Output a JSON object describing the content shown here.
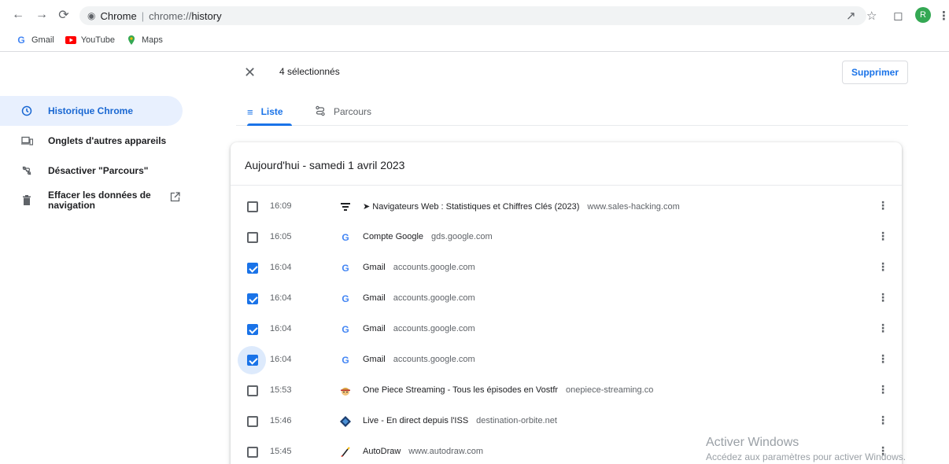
{
  "browser": {
    "origin": "Chrome",
    "url_scheme": "chrome://",
    "url_path": "history",
    "avatar_letter": "R"
  },
  "bookmarks": [
    {
      "label": "Gmail",
      "icon": "gmail-g-icon"
    },
    {
      "label": "YouTube",
      "icon": "youtube-icon"
    },
    {
      "label": "Maps",
      "icon": "maps-icon"
    }
  ],
  "selection": {
    "count_label": "4 sélectionnés",
    "delete_label": "Supprimer"
  },
  "sidebar": {
    "items": [
      {
        "label": "Historique Chrome",
        "icon": "clock-icon",
        "active": true
      },
      {
        "label": "Onglets d'autres appareils",
        "icon": "devices-icon"
      },
      {
        "label": "Désactiver \"Parcours\"",
        "icon": "journeys-off-icon"
      },
      {
        "label": "Effacer les données de navigation",
        "icon": "trash-icon"
      }
    ]
  },
  "tabs": {
    "list_label": "Liste",
    "journeys_label": "Parcours"
  },
  "history": {
    "date_header": "Aujourd'hui - samedi 1 avril 2023",
    "rows": [
      {
        "time": "16:09",
        "title": "➤ Navigateurs Web : Statistiques et Chiffres Clés (2023)",
        "domain": "www.sales-hacking.com",
        "checked": false
      },
      {
        "time": "16:05",
        "title": "Compte Google",
        "domain": "gds.google.com",
        "checked": false
      },
      {
        "time": "16:04",
        "title": "Gmail",
        "domain": "accounts.google.com",
        "checked": true
      },
      {
        "time": "16:04",
        "title": "Gmail",
        "domain": "accounts.google.com",
        "checked": true
      },
      {
        "time": "16:04",
        "title": "Gmail",
        "domain": "accounts.google.com",
        "checked": true
      },
      {
        "time": "16:04",
        "title": "Gmail",
        "domain": "accounts.google.com",
        "checked": true
      },
      {
        "time": "15:53",
        "title": "One Piece Streaming - Tous les épisodes en Vostfr",
        "domain": "onepiece-streaming.co",
        "checked": false
      },
      {
        "time": "15:46",
        "title": "Live - En direct depuis l'ISS",
        "domain": "destination-orbite.net",
        "checked": false
      },
      {
        "time": "15:45",
        "title": "AutoDraw",
        "domain": "www.autodraw.com",
        "checked": false
      }
    ]
  },
  "watermark": {
    "line1": "Activer Windows",
    "line2": "Accédez aux paramètres pour activer Windows."
  },
  "colors": {
    "accent": "#1a73e8",
    "active_bg": "#e8f0fe"
  }
}
